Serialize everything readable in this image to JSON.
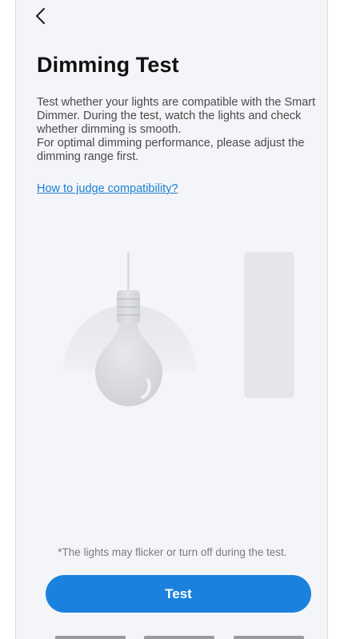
{
  "header": {
    "back_icon": "chevron-left-icon"
  },
  "main": {
    "title": "Dimming Test",
    "description": [
      "Test whether your lights are compatible with the Smart Dimmer. During the test, watch the lights and check whether dimming is smooth.",
      "For optimal dimming performance, please adjust the dimming range first."
    ],
    "compat_link": "How to judge compatibility?",
    "illustration": {
      "icons": [
        "light-bulb-icon",
        "dimmer-switch-icon"
      ]
    },
    "warning_note": "*The lights may flicker or turn off during the test.",
    "test_button": "Test"
  },
  "colors": {
    "accent": "#1a82de",
    "link": "#1a7fd4",
    "background": "#f4f5f8"
  }
}
